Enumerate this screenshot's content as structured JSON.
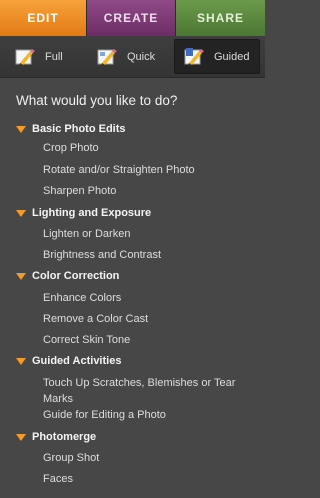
{
  "tabs": [
    {
      "label": "EDIT"
    },
    {
      "label": "CREATE"
    },
    {
      "label": "SHARE"
    }
  ],
  "modes": [
    {
      "label": "Full",
      "icon": "pencil-icon"
    },
    {
      "label": "Quick",
      "icon": "pencil-icon"
    },
    {
      "label": "Guided",
      "icon": "guided-pencil-icon",
      "selected": true
    }
  ],
  "heading": "What would you like to do?",
  "sections": [
    {
      "title": "Basic Photo Edits",
      "items": [
        "Crop Photo",
        "Rotate and/or Straighten Photo",
        "Sharpen Photo"
      ]
    },
    {
      "title": "Lighting and Exposure",
      "items": [
        "Lighten or Darken",
        "Brightness and Contrast"
      ]
    },
    {
      "title": "Color Correction",
      "items": [
        "Enhance Colors",
        "Remove a Color Cast",
        "Correct Skin Tone"
      ]
    },
    {
      "title": "Guided Activities",
      "items": [
        "Touch Up Scratches, Blemishes or Tear Marks",
        "Guide for Editing a Photo"
      ]
    },
    {
      "title": "Photomerge",
      "items": [
        "Group Shot",
        "Faces"
      ]
    }
  ],
  "colors": {
    "edit_tab": "#e8891f",
    "create_tab": "#7a3674",
    "share_tab": "#5a8a3d",
    "panel_bg": "#474747",
    "expander": "#f39b2b"
  }
}
